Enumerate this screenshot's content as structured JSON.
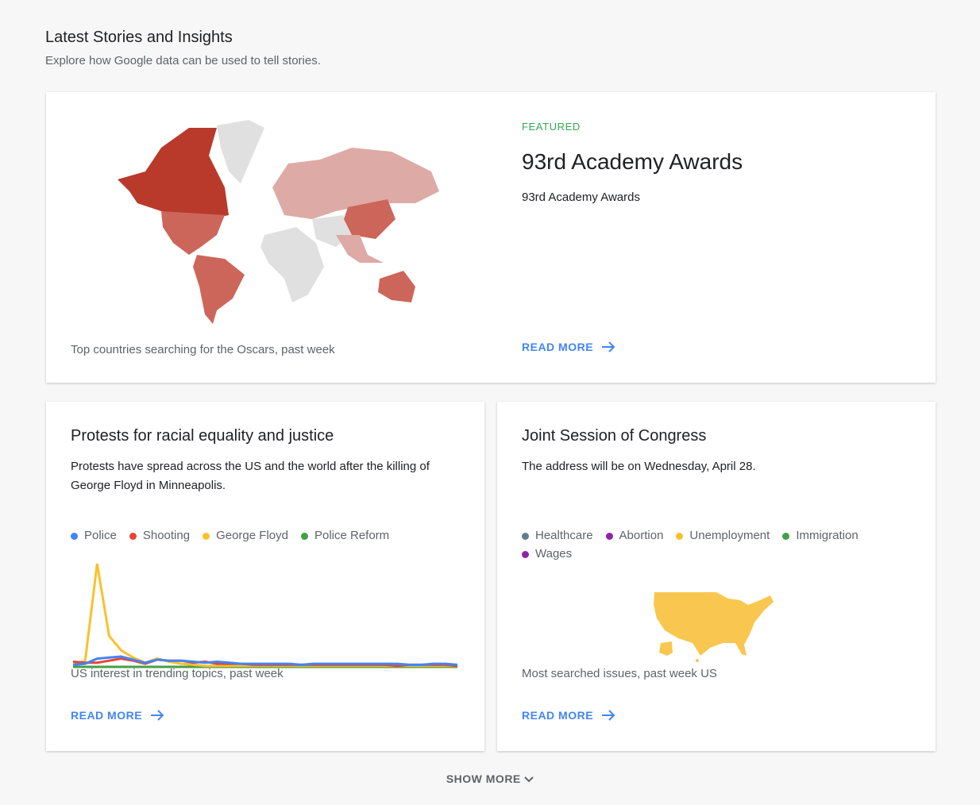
{
  "header": {
    "title": "Latest Stories and Insights",
    "subtitle": "Explore how Google data can be used to tell stories."
  },
  "featured": {
    "tag": "FEATURED",
    "title": "93rd Academy Awards",
    "description": "93rd Academy Awards",
    "caption": "Top countries searching for the Oscars, past week",
    "read_more": "READ MORE",
    "tag_color": "#34a853",
    "map_colors": [
      "#b93a2b",
      "#cd665a",
      "#deaaa5",
      "#e0e0e0"
    ]
  },
  "cards": [
    {
      "title": "Protests for racial equality and justice",
      "description": "Protests have spread across the US and the world after the killing of George Floyd in Minneapolis.",
      "caption": "US interest in trending topics, past week",
      "read_more": "READ MORE",
      "legend": [
        {
          "label": "Police",
          "color": "#4285f4"
        },
        {
          "label": "Shooting",
          "color": "#ea4335"
        },
        {
          "label": "George Floyd",
          "color": "#fbc02d"
        },
        {
          "label": "Police Reform",
          "color": "#43a047"
        }
      ]
    },
    {
      "title": "Joint Session of Congress",
      "description": "The address will be on Wednesday, April 28.",
      "caption": "Most searched issues, past week US",
      "read_more": "READ MORE",
      "map_color": "#f9c74f",
      "legend": [
        {
          "label": "Healthcare",
          "color": "#607d8b"
        },
        {
          "label": "Abortion",
          "color": "#8e24aa"
        },
        {
          "label": "Unemployment",
          "color": "#fbc02d"
        },
        {
          "label": "Immigration",
          "color": "#43a047"
        },
        {
          "label": "Wages",
          "color": "#8e24aa"
        }
      ]
    }
  ],
  "chart_data": {
    "type": "line",
    "ylim": [
      0,
      100
    ],
    "grid": false,
    "series": [
      {
        "name": "Police",
        "color": "#4285f4",
        "values": [
          2,
          3,
          8,
          9,
          10,
          7,
          4,
          7,
          6,
          6,
          5,
          4,
          5,
          4,
          3,
          3,
          3,
          3,
          3,
          2,
          3,
          3,
          3,
          3,
          3,
          3,
          3,
          3,
          2,
          2,
          3,
          3,
          2
        ]
      },
      {
        "name": "Shooting",
        "color": "#ea4335",
        "values": [
          5,
          4,
          4,
          6,
          8,
          6,
          3,
          7,
          6,
          6,
          4,
          5,
          3,
          3,
          3,
          2,
          2,
          2,
          2,
          2,
          2,
          2,
          2,
          2,
          2,
          2,
          2,
          1,
          2,
          2,
          2,
          2,
          1
        ]
      },
      {
        "name": "George Floyd",
        "color": "#fbc02d",
        "values": [
          4,
          5,
          100,
          30,
          16,
          9,
          4,
          8,
          5,
          3,
          2,
          1,
          1,
          1,
          1,
          1,
          1,
          1,
          1,
          1,
          1,
          1,
          1,
          1,
          1,
          1,
          1,
          1,
          1,
          1,
          1,
          1,
          1
        ]
      },
      {
        "name": "Police Reform",
        "color": "#43a047",
        "values": [
          0,
          0,
          0,
          0,
          0,
          0,
          0,
          0,
          0,
          0,
          0,
          0,
          0,
          0,
          0,
          0,
          0,
          0,
          0,
          0,
          0,
          0,
          0,
          0,
          0,
          0,
          0,
          0,
          0,
          0,
          0,
          0,
          0
        ]
      }
    ]
  },
  "footer": {
    "show_more": "SHOW MORE"
  }
}
